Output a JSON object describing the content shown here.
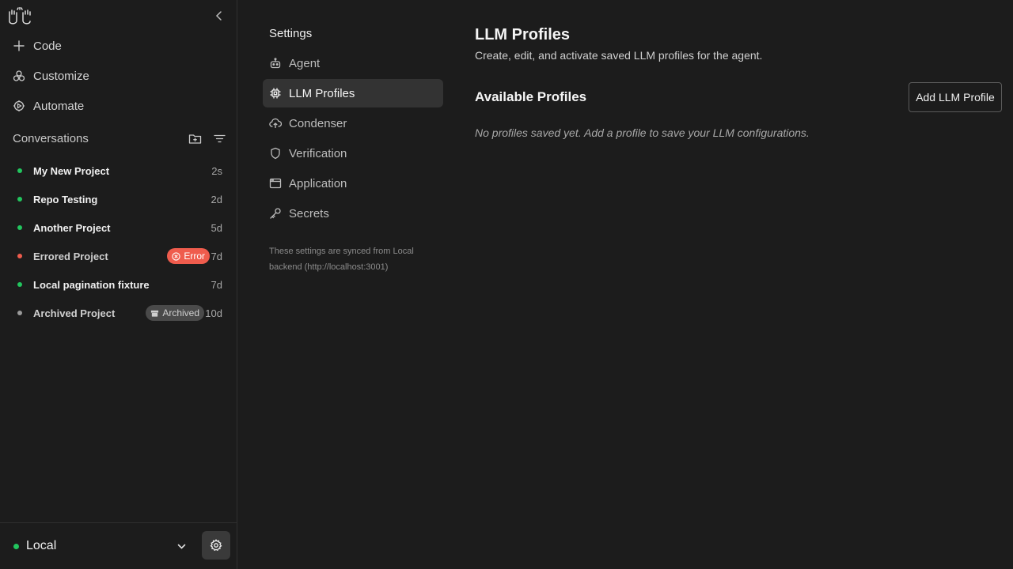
{
  "sidebar": {
    "nav": [
      {
        "label": "Code",
        "icon": "plus-icon"
      },
      {
        "label": "Customize",
        "icon": "customize-icon"
      },
      {
        "label": "Automate",
        "icon": "automate-icon"
      }
    ],
    "conversations_title": "Conversations",
    "conversations": [
      {
        "name": "My New Project",
        "time": "2s",
        "status_color": "#22c55e"
      },
      {
        "name": "Repo Testing",
        "time": "2d",
        "status_color": "#22c55e"
      },
      {
        "name": "Another Project",
        "time": "5d",
        "status_color": "#22c55e"
      },
      {
        "name": "Errored Project",
        "time": "7d",
        "status_color": "#ef5c4d",
        "badge": "Error"
      },
      {
        "name": "Local pagination fixture",
        "time": "7d",
        "status_color": "#22c55e"
      },
      {
        "name": "Archived Project",
        "time": "10d",
        "status_color": "#9a9a9a",
        "badge": "Archived"
      }
    ],
    "footer_label": "Local"
  },
  "settings": {
    "title": "Settings",
    "items": [
      {
        "label": "Agent",
        "icon": "agent-icon"
      },
      {
        "label": "LLM Profiles",
        "icon": "chip-icon",
        "active": true
      },
      {
        "label": "Condenser",
        "icon": "condenser-icon"
      },
      {
        "label": "Verification",
        "icon": "shield-icon"
      },
      {
        "label": "Application",
        "icon": "application-icon"
      },
      {
        "label": "Secrets",
        "icon": "key-icon"
      }
    ],
    "sync_note": "These settings are synced from Local backend (http://localhost:3001)"
  },
  "main": {
    "title": "LLM Profiles",
    "subtitle": "Create, edit, and activate saved LLM profiles for the agent.",
    "section_title": "Available Profiles",
    "add_button": "Add LLM Profile",
    "empty_text": "No profiles saved yet. Add a profile to save your LLM configurations."
  }
}
